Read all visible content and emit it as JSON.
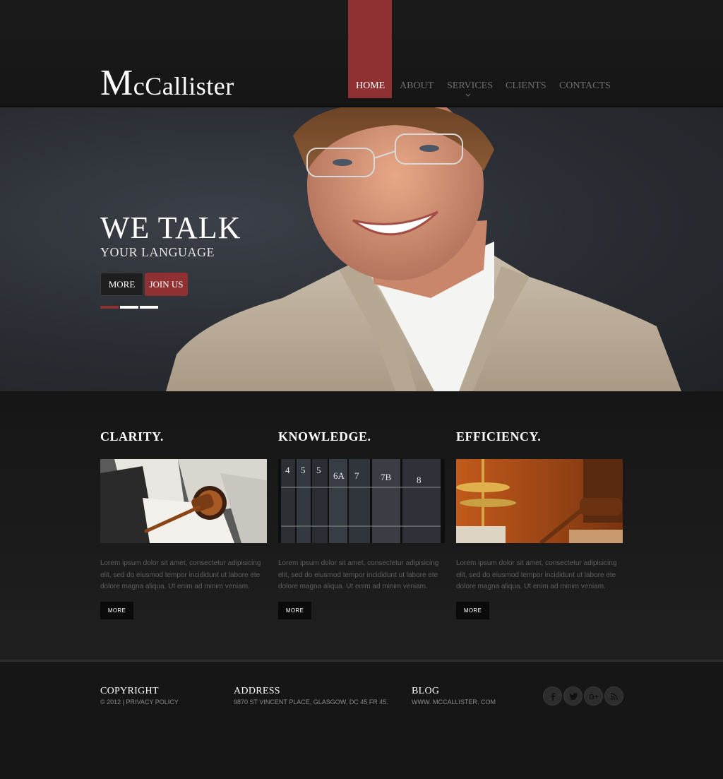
{
  "brand": {
    "logo_first": "M",
    "logo_rest": "cCallister"
  },
  "nav": {
    "items": [
      {
        "label": "HOME",
        "active": true
      },
      {
        "label": "ABOUT"
      },
      {
        "label": "SERVICES",
        "has_dropdown": true
      },
      {
        "label": "CLIENTS"
      },
      {
        "label": "CONTACTS"
      }
    ]
  },
  "hero": {
    "title": "WE TALK",
    "subtitle": "YOUR LANGUAGE",
    "more_label": "MORE",
    "join_label": "JOIN US",
    "slides": 3,
    "active_slide": 1
  },
  "features": [
    {
      "title": "CLARITY.",
      "image": "books-and-gavel",
      "text": "Lorem ipsum dolor sit amet, consectetur adipisicing elit, sed do eiusmod tempor incididunt ut labore ete dolore magna aliqua. Ut enim ad minim veniam.",
      "more_label": "MORE"
    },
    {
      "title": "KNOWLEDGE.",
      "image": "law-book-spines",
      "text": "Lorem ipsum dolor sit amet, consectetur adipisicing elit, sed do eiusmod tempor incididunt ut labore ete dolore magna aliqua. Ut enim ad minim veniam.",
      "more_label": "MORE"
    },
    {
      "title": "EFFICIENCY.",
      "image": "scales-and-gavel",
      "text": "Lorem ipsum dolor sit amet, consectetur adipisicing elit, sed do eiusmod tempor incididunt ut labore ete dolore magna aliqua. Ut enim ad minim veniam.",
      "more_label": "MORE"
    }
  ],
  "footer": {
    "copyright_heading": "COPYRIGHT",
    "copyright_text": "© 2012 |",
    "privacy_label": "PRIVACY POLICY",
    "address_heading": "ADDRESS",
    "address_text": "9870 ST VINCENT PLACE, GLASGOW, DC 45 FR 45.",
    "blog_heading": "BLOG",
    "blog_text": "WWW. MCCALLISTER. COM",
    "social": [
      "facebook-icon",
      "twitter-icon",
      "google-plus-icon",
      "rss-icon"
    ]
  },
  "colors": {
    "accent": "#8f3032",
    "background": "#1b1b1b"
  }
}
